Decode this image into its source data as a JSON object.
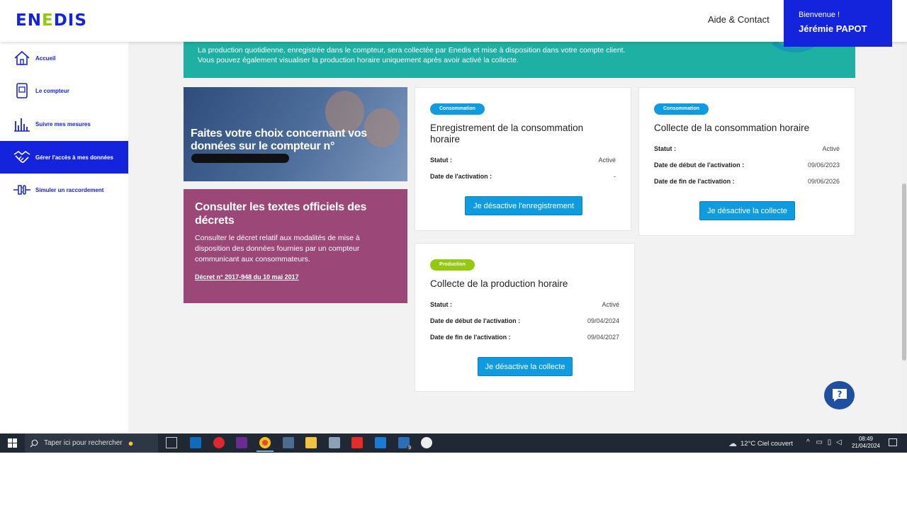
{
  "header": {
    "logo": "ENEDIS",
    "help_link": "Aide & Contact",
    "welcome_label": "Bienvenue !",
    "user_name": "Jérémie PAPOT",
    "brand_color": "#1423dc",
    "accent_color": "#93c90e"
  },
  "sidebar": {
    "items": [
      {
        "label": "Accueil",
        "icon": "home-icon"
      },
      {
        "label": "Le compteur",
        "icon": "meter-icon"
      },
      {
        "label": "Suivre mes mesures",
        "icon": "chart-bars-icon"
      },
      {
        "label": "Gérer l'accès à mes données",
        "icon": "handshake-icon",
        "active": true
      },
      {
        "label": "Simuler un raccordement",
        "icon": "plug-icon"
      }
    ]
  },
  "banner": {
    "line1": "La production quotidienne, enregistrée dans le compteur, sera collectée par Enedis et mise à disposition dans votre compte client.",
    "line2": "Vous pouvez également visualiser la production horaire uniquement après avoir activé la collecte.",
    "color": "#1eb0a3"
  },
  "promo": {
    "title": "Faites votre choix concernant vos données sur le compteur n°"
  },
  "decrets": {
    "title": "Consulter les textes officiels des décrets",
    "text": "Consulter le décret relatif aux modalités de mise à disposition des données fournies par un compteur communicant aux consommateurs.",
    "link": "Décret n° 2017-948 du 10 mai 2017",
    "color": "#9b4778"
  },
  "cards": {
    "enregistrement": {
      "badge": "Consommation",
      "title": "Enregistrement de la consommation horaire",
      "statut_label": "Statut :",
      "statut_value": "Activé",
      "date_label": "Date de l'activation :",
      "date_value": "-",
      "button": "Je désactive l'enregistrement"
    },
    "collecte_conso": {
      "badge": "Consommation",
      "title": "Collecte de la consommation horaire",
      "statut_label": "Statut :",
      "statut_value": "Activé",
      "start_label": "Date de début de l'activation :",
      "start_value": "09/06/2023",
      "end_label": "Date de fin de l'activation :",
      "end_value": "09/06/2026",
      "button": "Je désactive la collecte"
    },
    "collecte_prod": {
      "badge": "Production",
      "title": "Collecte de la production horaire",
      "statut_label": "Statut :",
      "statut_value": "Activé",
      "start_label": "Date de début de l'activation :",
      "start_value": "09/04/2024",
      "end_label": "Date de fin de l'activation :",
      "end_value": "09/04/2027",
      "button": "Je désactive la collecte"
    }
  },
  "taskbar": {
    "search_placeholder": "Taper ici pour rechercher",
    "weather": "12°C  Ciel couvert",
    "time": "08:49",
    "date": "21/04/2024",
    "mail_badge": "9"
  }
}
